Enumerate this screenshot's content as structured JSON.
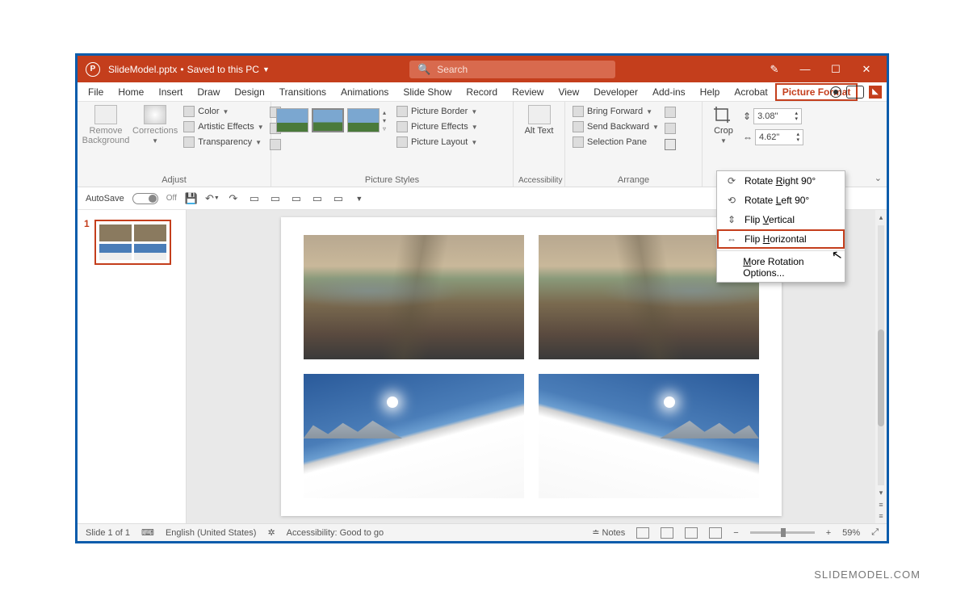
{
  "titlebar": {
    "filename": "SlideModel.pptx",
    "save_state": "Saved to this PC",
    "search_placeholder": "Search"
  },
  "tabs": [
    "File",
    "Home",
    "Insert",
    "Draw",
    "Design",
    "Transitions",
    "Animations",
    "Slide Show",
    "Record",
    "Review",
    "View",
    "Developer",
    "Add-ins",
    "Help",
    "Acrobat",
    "Picture Format"
  ],
  "active_tab": "Picture Format",
  "ribbon": {
    "adjust": {
      "label": "Adjust",
      "remove_bg": "Remove Background",
      "corrections": "Corrections",
      "color": "Color",
      "artistic": "Artistic Effects",
      "transparency": "Transparency"
    },
    "picture_styles": {
      "label": "Picture Styles",
      "border": "Picture Border",
      "effects": "Picture Effects",
      "layout": "Picture Layout"
    },
    "accessibility": {
      "label": "Accessibility",
      "alt_text": "Alt Text"
    },
    "arrange": {
      "label": "Arrange",
      "bring_forward": "Bring Forward",
      "send_backward": "Send Backward",
      "selection_pane": "Selection Pane"
    },
    "size": {
      "crop": "Crop",
      "height": "3.08\"",
      "width": "4.62\""
    }
  },
  "qat": {
    "autosave": "AutoSave",
    "autosave_state": "Off"
  },
  "dropdown": {
    "rotate_right": "Rotate Right 90°",
    "rotate_left": "Rotate Left 90°",
    "flip_vertical": "Flip Vertical",
    "flip_horizontal": "Flip Horizontal",
    "more": "More Rotation Options..."
  },
  "slidepanel": {
    "slide_number": "1"
  },
  "statusbar": {
    "slide_info": "Slide 1 of 1",
    "language": "English (United States)",
    "accessibility": "Accessibility: Good to go",
    "notes": "Notes",
    "zoom": "59%"
  },
  "watermark": "SLIDEMODEL.COM"
}
